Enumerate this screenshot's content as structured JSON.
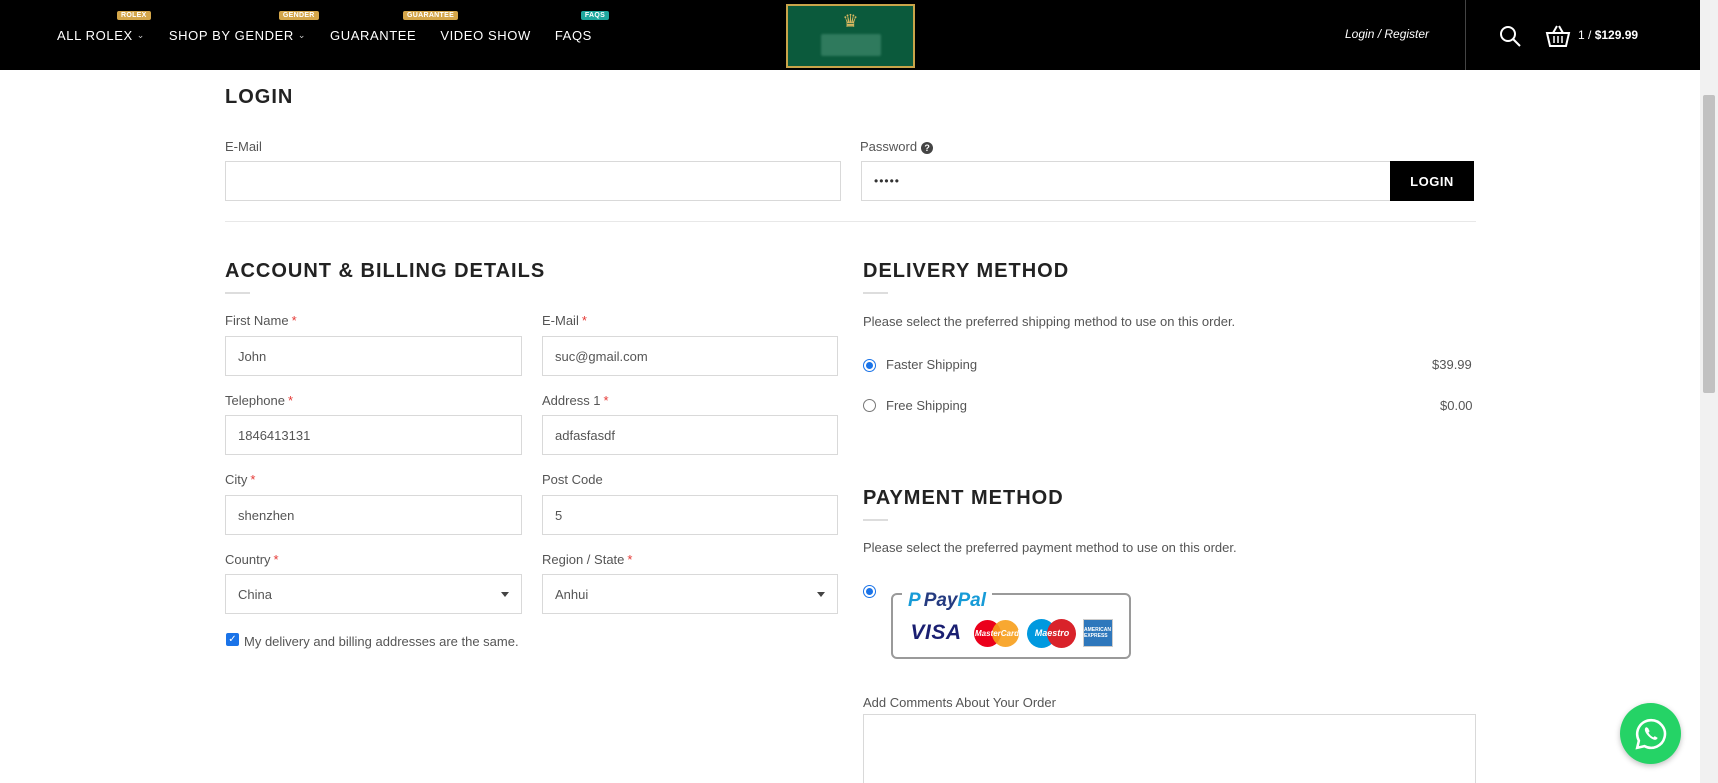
{
  "header": {
    "nav": [
      {
        "label": "ALL ROLEX",
        "badge": "ROLEX",
        "badge_color": "#d4a64a",
        "has_dropdown": true
      },
      {
        "label": "SHOP BY GENDER",
        "badge": "GENDER",
        "badge_color": "#d4a64a",
        "has_dropdown": true
      },
      {
        "label": "GUARANTEE",
        "badge": "GUARANTEE",
        "badge_color": "#d4a64a",
        "has_dropdown": false
      },
      {
        "label": "VIDEO SHOW",
        "badge": "",
        "has_dropdown": false
      },
      {
        "label": "FAQS",
        "badge": "FAQS",
        "badge_color": "#1fa79e",
        "has_dropdown": false
      }
    ],
    "login_register": "Login / Register",
    "cart_count": "1 /",
    "cart_total": "$129.99",
    "icons": {
      "search": "search-icon",
      "cart": "basket-icon",
      "logo": "crown-logo"
    }
  },
  "login": {
    "title": "LOGIN",
    "email_label": "E-Mail",
    "email_value": "",
    "password_label": "Password",
    "password_value": "•••••",
    "login_button": "LOGIN"
  },
  "account": {
    "title": "ACCOUNT & BILLING DETAILS",
    "fields": {
      "first_name": {
        "label": "First Name",
        "value": "John",
        "required": "*"
      },
      "email": {
        "label": "E-Mail",
        "value": "suc@gmail.com",
        "required": "*"
      },
      "telephone": {
        "label": "Telephone",
        "value": "1846413131",
        "required": "*"
      },
      "address1": {
        "label": "Address 1",
        "value": "adfasfasdf",
        "required": "*"
      },
      "city": {
        "label": "City",
        "value": "shenzhen",
        "required": "*"
      },
      "post_code": {
        "label": "Post Code",
        "value": "5"
      },
      "country": {
        "label": "Country",
        "value": "China",
        "required": "*"
      },
      "region": {
        "label": "Region / State",
        "value": "Anhui",
        "required": "*"
      }
    },
    "same_address_label": "My delivery and billing addresses are the same.",
    "same_address_checked": true
  },
  "delivery": {
    "title": "DELIVERY METHOD",
    "intro": "Please select the preferred shipping method to use on this order.",
    "options": [
      {
        "label": "Faster Shipping",
        "price": "$39.99",
        "selected": true
      },
      {
        "label": "Free Shipping",
        "price": "$0.00",
        "selected": false
      }
    ]
  },
  "payment": {
    "title": "PAYMENT METHOD",
    "intro": "Please select the preferred payment method to use on this order.",
    "paypal_brand_a": "Pay",
    "paypal_brand_b": "Pal",
    "cards": {
      "visa": "VISA",
      "mastercard": "MasterCard",
      "maestro": "Maestro",
      "amex": "AMERICAN EXPRESS"
    },
    "comments_label": "Add Comments About Your Order",
    "comments_value": ""
  },
  "colors": {
    "accent": "#1a73e8",
    "header_bg": "#000000",
    "whatsapp": "#25d366",
    "required": "#e53935"
  }
}
